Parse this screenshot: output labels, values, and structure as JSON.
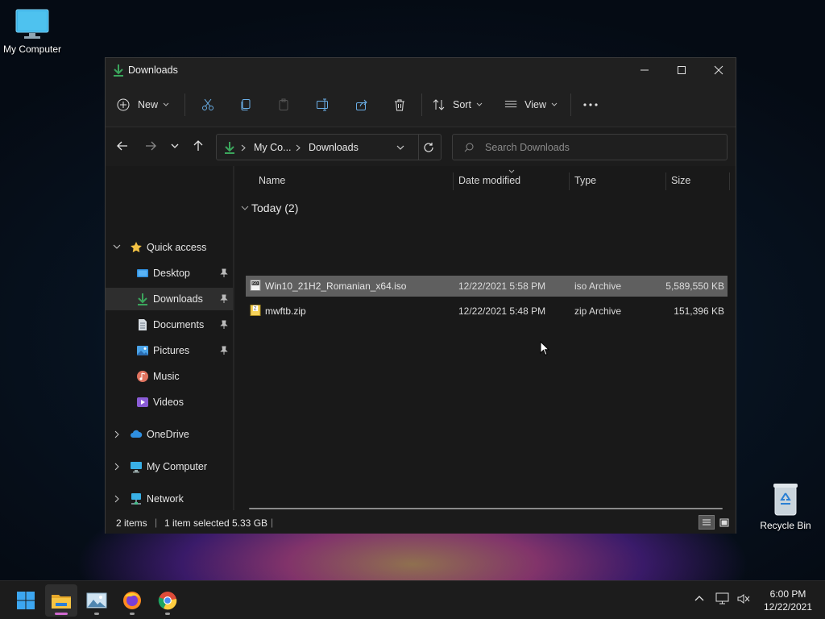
{
  "desktop": {
    "icons": [
      {
        "label": "My Computer"
      },
      {
        "label": "Recycle Bin"
      }
    ]
  },
  "window": {
    "title": "Downloads",
    "controls": {
      "minimize": "minimize-icon",
      "maximize": "maximize-icon",
      "close": "close-icon"
    }
  },
  "toolbar": {
    "new_label": "New",
    "sort_label": "Sort",
    "view_label": "View",
    "actions": [
      "cut",
      "copy",
      "paste",
      "rename",
      "share",
      "delete"
    ]
  },
  "address": {
    "crumbs": [
      "My Co...",
      "Downloads"
    ],
    "search_placeholder": "Search Downloads"
  },
  "sidebar": {
    "quick_access": "Quick access",
    "items": [
      {
        "label": "Desktop",
        "pinned": true
      },
      {
        "label": "Downloads",
        "pinned": true
      },
      {
        "label": "Documents",
        "pinned": true
      },
      {
        "label": "Pictures",
        "pinned": true
      },
      {
        "label": "Music"
      },
      {
        "label": "Videos"
      }
    ],
    "roots": [
      {
        "label": "OneDrive"
      },
      {
        "label": "My Computer"
      },
      {
        "label": "Network"
      }
    ]
  },
  "columns": {
    "name": "Name",
    "date": "Date modified",
    "type": "Type",
    "size": "Size"
  },
  "group": {
    "label": "Today (2)"
  },
  "files": [
    {
      "name": "Win10_21H2_Romanian_x64.iso",
      "date": "12/22/2021 5:58 PM",
      "type": "iso Archive",
      "size": "5,589,550 KB",
      "selected": true
    },
    {
      "name": "mwftb.zip",
      "date": "12/22/2021 5:48 PM",
      "type": "zip Archive",
      "size": "151,396 KB",
      "selected": false
    }
  ],
  "status": {
    "items": "2 items",
    "selected": "1 item selected",
    "size": "5.33 GB",
    "separator": "|"
  },
  "taskbar": {
    "time": "6:00 PM",
    "date": "12/22/2021"
  },
  "colors": {
    "accent": "#3ba55c",
    "folder": "#f3c244",
    "selection": "#5f5f5f"
  }
}
